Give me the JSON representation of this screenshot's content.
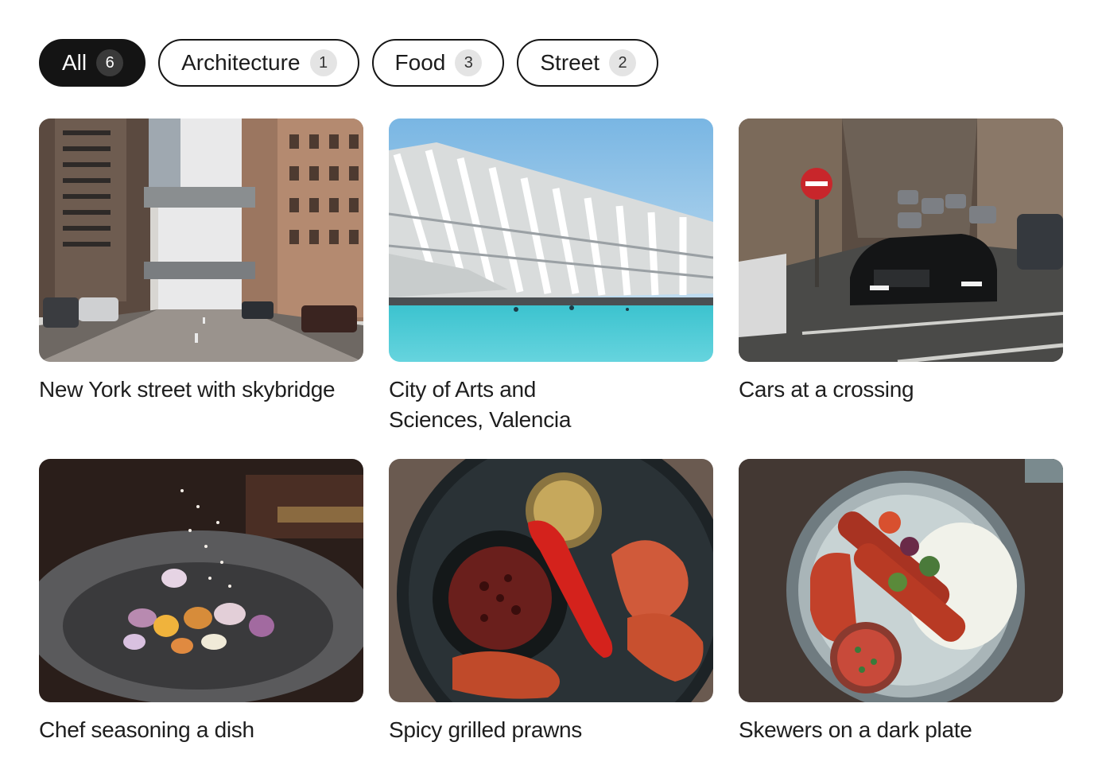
{
  "filters": [
    {
      "label": "All",
      "count": "6",
      "active": true
    },
    {
      "label": "Architecture",
      "count": "1",
      "active": false
    },
    {
      "label": "Food",
      "count": "3",
      "active": false
    },
    {
      "label": "Street",
      "count": "2",
      "active": false
    }
  ],
  "photos": [
    {
      "caption": "New York street with skybridge",
      "image": "new-york-street-photo"
    },
    {
      "caption": "City of Arts and Sciences, Valencia",
      "image": "valencia-architecture-photo"
    },
    {
      "caption": "Cars at a crossing",
      "image": "cars-crossing-photo"
    },
    {
      "caption": "Chef seasoning a dish",
      "image": "chef-seasoning-photo"
    },
    {
      "caption": "Spicy grilled prawns",
      "image": "grilled-prawns-photo"
    },
    {
      "caption": "Skewers on a dark plate",
      "image": "skewers-plate-photo"
    }
  ],
  "colors": {
    "active_chip_bg": "#141414",
    "chip_border": "#161616",
    "count_badge_bg": "#e4e4e4",
    "text": "#1e1e1e"
  }
}
